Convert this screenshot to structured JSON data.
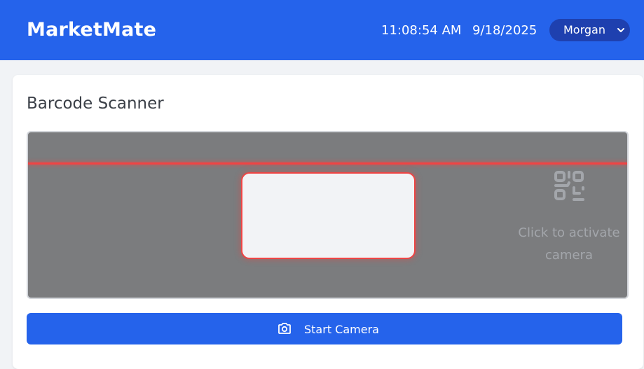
{
  "header": {
    "app_name": "MarketMate",
    "time": "11:08:54 AM",
    "date": "9/18/2025",
    "user_selected": "Morgan",
    "colors": {
      "bar": "#2563eb",
      "user_pill": "#1e40af"
    }
  },
  "scanner": {
    "title": "Barcode Scanner",
    "hint": "Click to activate camera",
    "icon": "qr-code-icon",
    "colors": {
      "viewport": "#7b7c7e",
      "scanline": "#ef4444"
    }
  },
  "actions": {
    "start_camera_label": "Start Camera",
    "start_camera_icon": "camera-icon"
  }
}
